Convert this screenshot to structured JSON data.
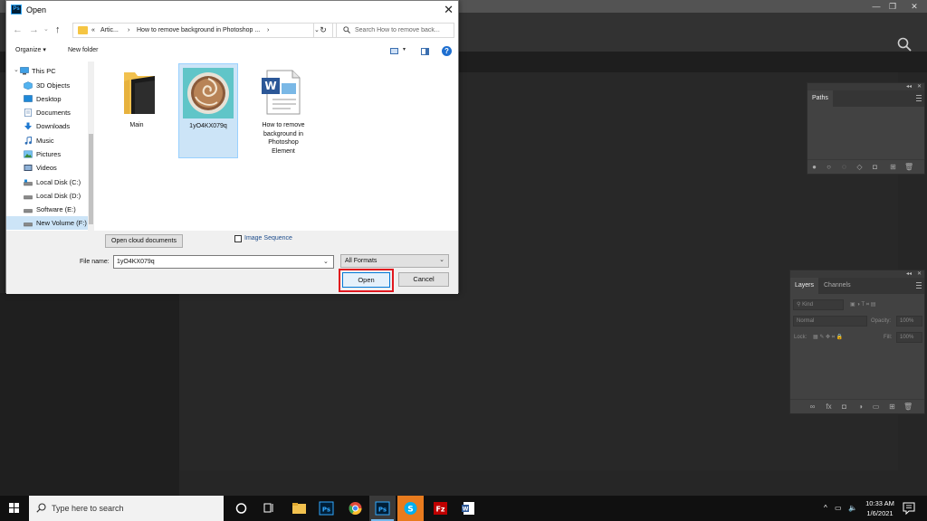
{
  "dialog": {
    "title": "Open",
    "app_icon_text": "Ps",
    "breadcrumb": {
      "prefix": "«",
      "items": [
        "Artic...",
        "How to remove background in Photoshop ..."
      ]
    },
    "search_placeholder": "Search How to remove back...",
    "toolbar": {
      "organize": "Organize ▾",
      "new_folder": "New folder"
    },
    "nav_items": [
      {
        "label": "This PC"
      },
      {
        "label": "3D Objects"
      },
      {
        "label": "Desktop"
      },
      {
        "label": "Documents"
      },
      {
        "label": "Downloads"
      },
      {
        "label": "Music"
      },
      {
        "label": "Pictures"
      },
      {
        "label": "Videos"
      },
      {
        "label": "Local Disk (C:)"
      },
      {
        "label": "Local Disk (D:)"
      },
      {
        "label": "Software (E:)"
      },
      {
        "label": "New Volume (F:)"
      }
    ],
    "files": [
      {
        "name": "Main",
        "type": "folder"
      },
      {
        "name": "1yO4KX079q",
        "type": "image",
        "selected": true
      },
      {
        "name": "How to remove background in Photoshop Element",
        "lines": [
          "How to remove",
          "background in",
          "Photoshop",
          "Element"
        ],
        "type": "document"
      }
    ],
    "open_cloud_label": "Open cloud documents",
    "image_sequence_label": "Image Sequence",
    "file_name_label": "File name:",
    "file_name_value": "1yO4KX079q",
    "format_value": "All Formats",
    "open_label": "Open",
    "cancel_label": "Cancel"
  },
  "photoshop": {
    "paths_panel": {
      "tab": "Paths"
    },
    "layers_panel": {
      "tabs": [
        "Layers",
        "Channels"
      ],
      "kind_placeholder": "Kind",
      "blend_mode": "Normal",
      "opacity_label": "Opacity:",
      "opacity_value": "100%",
      "lock_label": "Lock:",
      "fill_label": "Fill:",
      "fill_value": "100%"
    }
  },
  "taskbar": {
    "search_placeholder": "Type here to search",
    "time": "10:33 AM",
    "date": "1/6/2021"
  },
  "colors": {
    "accent_blue": "#0078d7",
    "highlight_red": "#e0181f",
    "selection": "#cce4f7",
    "ps_dark": "#262626"
  }
}
